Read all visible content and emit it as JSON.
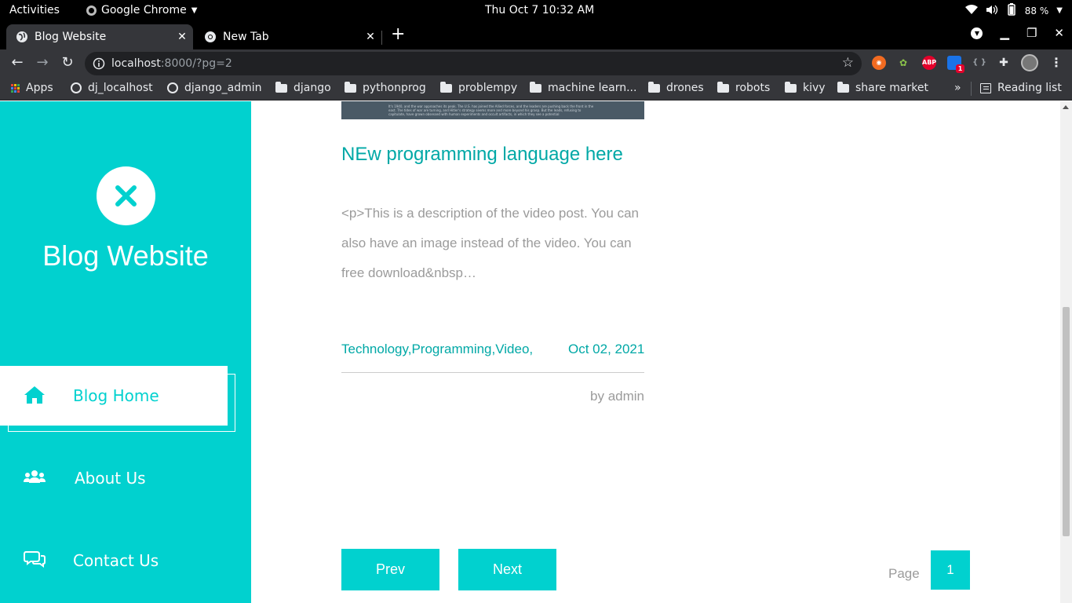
{
  "topbar": {
    "activities": "Activities",
    "app_name": "Google Chrome",
    "clock": "Thu Oct 7  10:32 AM",
    "battery": "88 %"
  },
  "tabs": [
    {
      "title": "Blog Website"
    },
    {
      "title": "New Tab"
    }
  ],
  "toolbar": {
    "url_host": "localhost",
    "url_rest": ":8000/?pg=2",
    "ext_abp": "ABP",
    "ext_badge": "1"
  },
  "bookmarks": [
    "Apps",
    "dj_localhost",
    "django_admin",
    "django",
    "pythonprog",
    "problempy",
    "machine learn...",
    "drones",
    "robots",
    "kivy",
    "share market"
  ],
  "bookmarks_overflow": "»",
  "reading_list": "Reading list",
  "sidebar": {
    "brand": "Blog Website",
    "nav": [
      {
        "label": "Blog Home",
        "icon": "home-icon"
      },
      {
        "label": "About Us",
        "icon": "users-icon"
      },
      {
        "label": "Contact Us",
        "icon": "comments-icon"
      }
    ]
  },
  "post": {
    "title": "NEw programming language here",
    "description": "<p>This is a description of the video post. You can also have an image instead of the video. You can free download&nbsp…",
    "categories": "Technology,Programming,Video,",
    "date": "Oct 02, 2021",
    "author": "by admin",
    "image_text": "It's 1940, and the war approaches its peak. The U.S. has joined the Allied forces, and the leaders are pushing back the front in the east. The tides of war are turning, and Hitler's strategy seems more and more beyond his grasp. But the leads, refusing to capitulate, have grown obsessed with human experiments and occult artifacts, in which they see a potential"
  },
  "pagination": {
    "prev": "Prev",
    "next": "Next",
    "page_label": "Page",
    "current_page": "1"
  },
  "colors": {
    "accent": "#01d1cf",
    "title": "#00a8a6",
    "muted": "#9b9b9b"
  }
}
